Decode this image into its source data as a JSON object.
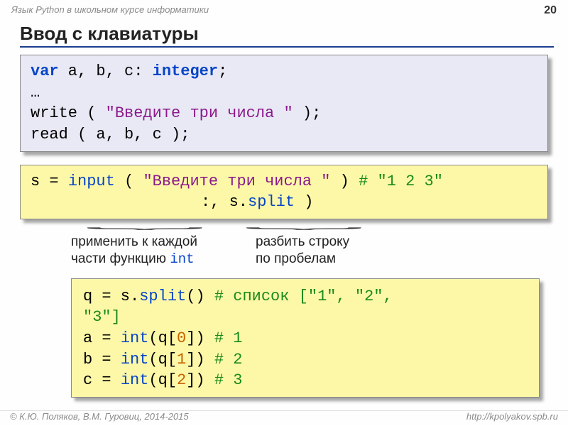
{
  "header": {
    "course": "Язык Python в школьном курсе информатики",
    "page": "20"
  },
  "title": "Ввод с клавиатуры",
  "pascal": {
    "l1a": "var",
    "l1b": " a, b, c: ",
    "l1c": "integer",
    "l1d": ";",
    "l2": "…",
    "l3a": "write ( ",
    "l3b": "\"Введите три числа \"",
    "l3c": " );",
    "l4": "read ( a, b, c );"
  },
  "py1": {
    "l1a": "s = ",
    "l1b": "input",
    "l1c": " ( ",
    "l1d": "\"Введите три числа \"",
    "l1e": " ) ",
    "l1f": "# \"1 2 3\"",
    "l2a": "",
    "l2b": ":, s.",
    "l2c": "split",
    "l2d": "   )"
  },
  "annot": {
    "a1l1": "применить к каждой",
    "a1l2a": "части функцию ",
    "a1l2b": "int",
    "a2l1": "разбить строку",
    "a2l2": "по пробелам"
  },
  "py2": {
    "l1a": "q = s.",
    "l1b": "split",
    "l1c": "()  ",
    "l1d": "# список [\"1\", \"2\",",
    "l1e": "\"3\"]",
    "l2a": "a = ",
    "l2b": "int",
    "l2c": "(q[",
    "l2d": "0",
    "l2e": "])  ",
    "l2f": "# 1",
    "l3a": "b = ",
    "l3b": "int",
    "l3c": "(q[",
    "l3d": "1",
    "l3e": "])  ",
    "l3f": "# 2",
    "l4a": "c = ",
    "l4b": "int",
    "l4c": "(q[",
    "l4d": "2",
    "l4e": "])  ",
    "l4f": "# 3"
  },
  "footer": {
    "copy": "© К.Ю. Поляков, В.М. Гуровиц, 2014-2015",
    "url": "http://kpolyakov.spb.ru"
  }
}
